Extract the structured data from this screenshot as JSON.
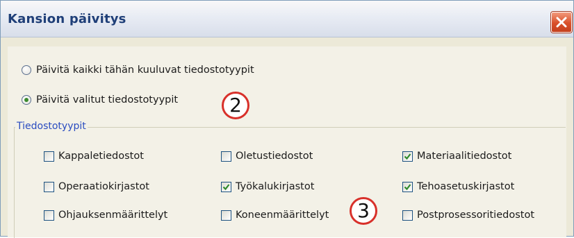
{
  "window": {
    "title": "Kansion päivitys",
    "close_icon": "close-icon"
  },
  "radios": [
    {
      "label": "Päivitä kaikki tähän kuuluvat tiedostotyypit",
      "checked": false
    },
    {
      "label": "Päivitä valitut tiedostotyypit",
      "checked": true
    }
  ],
  "badges": {
    "radio_step": "2",
    "checkbox_step": "3"
  },
  "group": {
    "label": "Tiedostotyypit",
    "items": [
      {
        "label": "Kappaletiedostot",
        "checked": false
      },
      {
        "label": "Oletustiedostot",
        "checked": false
      },
      {
        "label": "Materiaalitiedostot",
        "checked": true
      },
      {
        "label": "Operaatiokirjastot",
        "checked": false
      },
      {
        "label": "Työkalukirjastot",
        "checked": true
      },
      {
        "label": "Tehoasetuskirjastot",
        "checked": true
      },
      {
        "label": "Ohjauksenmäärittelyt",
        "checked": false
      },
      {
        "label": "Koneenmäärittelyt",
        "checked": false
      },
      {
        "label": "Postprosessoritiedostot",
        "checked": false
      }
    ]
  },
  "colors": {
    "title_text": "#1f3f78",
    "group_label": "#2a4cc0",
    "check_mark": "#2f8a2a",
    "badge_ring": "#d8302a"
  }
}
